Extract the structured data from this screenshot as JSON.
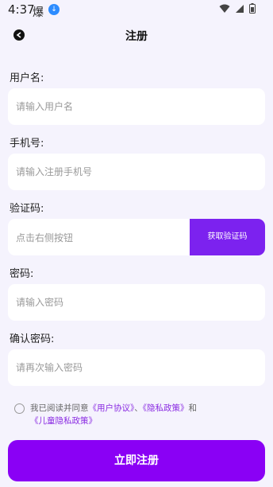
{
  "status_bar": {
    "time": "4:37",
    "app_icon": "爆",
    "download_icon": "↓"
  },
  "header": {
    "title": "注册"
  },
  "form": {
    "username": {
      "label": "用户名:",
      "placeholder": "请输入用户名"
    },
    "phone": {
      "label": "手机号:",
      "placeholder": "请输入注册手机号"
    },
    "code": {
      "label": "验证码:",
      "placeholder": "点击右侧按钮",
      "button": "获取验证码"
    },
    "password": {
      "label": "密码:",
      "placeholder": "请输入密码"
    },
    "confirm": {
      "label": "确认密码:",
      "placeholder": "请再次输入密码"
    }
  },
  "agreement": {
    "prefix": "我已阅读并同意",
    "user_agreement": "《用户协议》",
    "sep1": "、",
    "privacy_policy": "《隐私政策》",
    "and": "和",
    "child_privacy": "《儿童隐私政策》"
  },
  "submit": {
    "label": "立即注册"
  },
  "colors": {
    "background": "#f5f3fd",
    "primary": "#8a00f5",
    "link": "#8a2be2"
  }
}
